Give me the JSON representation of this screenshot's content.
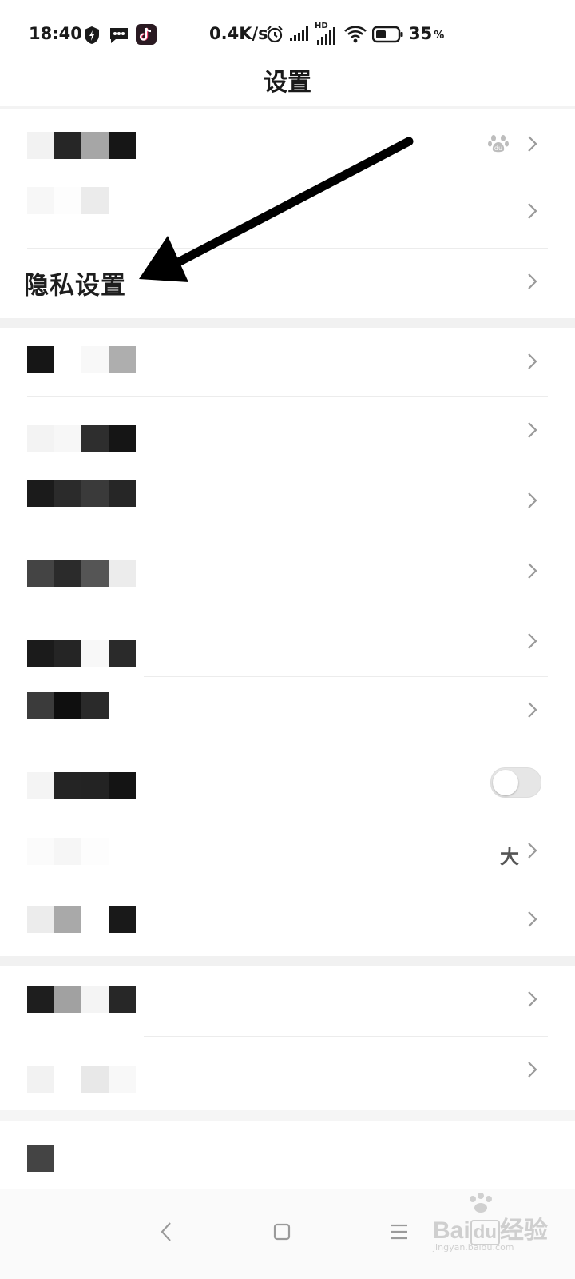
{
  "status_bar": {
    "time": "18:40",
    "net_speed": "0.4K/s",
    "battery_pct": "35",
    "battery_unit": "%",
    "hd_badge": "HD",
    "notification_icons": [
      "shield-bolt-icon",
      "message-icon",
      "tiktok-icon"
    ],
    "system_icons": [
      "alarm-icon",
      "signal-icon",
      "hd-signal-icon",
      "wifi-icon",
      "battery-icon"
    ]
  },
  "header": {
    "title": "设置"
  },
  "sections": [
    {
      "rows": [
        {
          "id": "account",
          "label_redacted": true,
          "trailing": "paw-icon"
        },
        {
          "id": "row-2",
          "label_redacted": true
        },
        {
          "id": "privacy",
          "label": "隐私设置"
        }
      ]
    },
    {
      "rows": [
        {
          "id": "row-4",
          "label_redacted": true
        },
        {
          "id": "row-5",
          "label_redacted": true
        },
        {
          "id": "row-6",
          "label_redacted": true
        },
        {
          "id": "row-7",
          "label_redacted": true
        },
        {
          "id": "row-8",
          "label_redacted": true
        },
        {
          "id": "row-9",
          "label_redacted": true
        },
        {
          "id": "row-10",
          "label_redacted": true,
          "toggle": false
        },
        {
          "id": "row-11",
          "label_redacted": true,
          "value": "大"
        },
        {
          "id": "row-12",
          "label_redacted": true
        }
      ]
    },
    {
      "rows": [
        {
          "id": "row-13",
          "label_redacted": true
        },
        {
          "id": "row-14",
          "label_redacted": true
        }
      ]
    },
    {
      "rows": [
        {
          "id": "row-15",
          "label_redacted": true
        }
      ]
    }
  ],
  "annotation": {
    "arrow_points_to": "隐私设置"
  },
  "nav_bar": {
    "buttons": [
      "back-icon",
      "home-icon",
      "recents-icon"
    ]
  },
  "watermark": {
    "brand": "Bai",
    "brand_suffix": "经验",
    "url": "jingyan.baidu.com"
  },
  "colors": {
    "background": "#ffffff",
    "section_gap": "#f1f1f1",
    "text": "#1e1e1e",
    "chevron": "#9a9a9a"
  }
}
